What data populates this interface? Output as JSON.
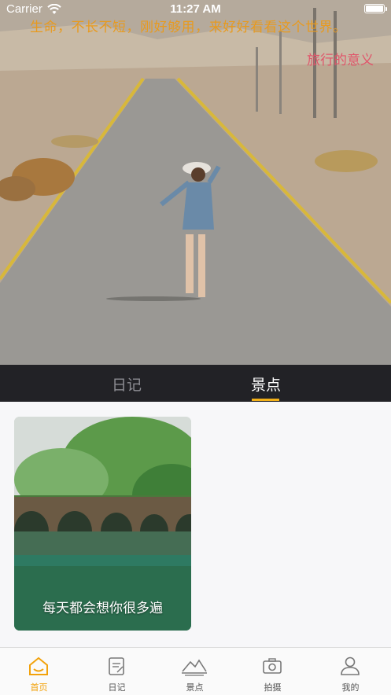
{
  "status_bar": {
    "carrier": "Carrier",
    "time": "11:27 AM",
    "wifi_icon": "wifi-icon",
    "battery_icon": "battery-icon"
  },
  "hero": {
    "quote": "生命，不长不短，刚好够用，来好好看看这个世界。",
    "signature": "旅行的意义",
    "quote_color": "#e89a1e",
    "signature_color": "#e0556a"
  },
  "segments": {
    "items": [
      {
        "label": "日记"
      },
      {
        "label": "景点"
      }
    ],
    "active_index": 1,
    "accent": "#f2b018"
  },
  "cards": [
    {
      "caption": "每天都会想你很多遍"
    }
  ],
  "tabbar": {
    "items": [
      {
        "label": "首页",
        "icon": "home-icon"
      },
      {
        "label": "日记",
        "icon": "diary-icon"
      },
      {
        "label": "景点",
        "icon": "scenery-icon"
      },
      {
        "label": "拍摄",
        "icon": "camera-icon"
      },
      {
        "label": "我的",
        "icon": "profile-icon"
      }
    ],
    "active_index": 0,
    "active_color": "#f2a20b"
  }
}
